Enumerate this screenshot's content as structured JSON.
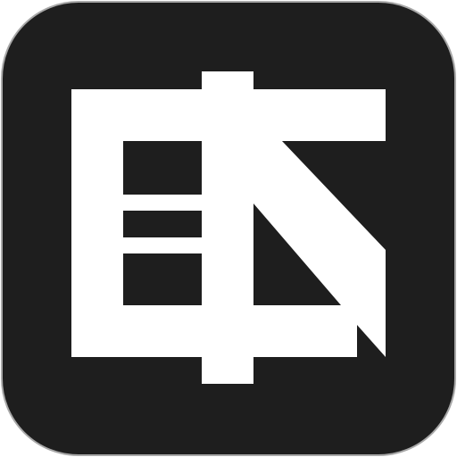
{
  "icon": {
    "name": "app-logo-icon",
    "colors": {
      "tile_background": "#1e1e1e",
      "tile_border": "#a8a8a8",
      "glyph": "#ffffff",
      "page_background": "#ffffff"
    }
  }
}
